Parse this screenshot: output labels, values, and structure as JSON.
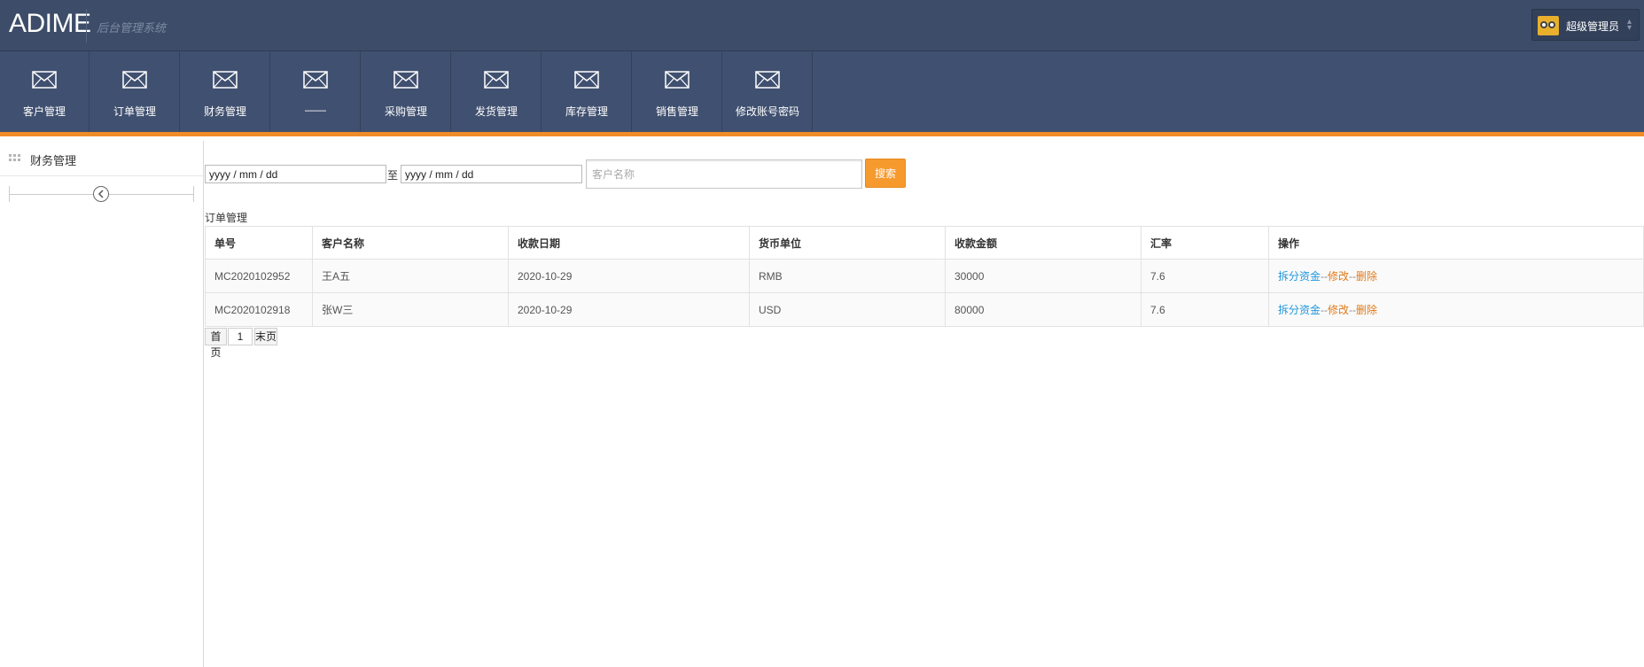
{
  "header": {
    "logo": "ADIME",
    "subtitle": "后台管理系统",
    "user": "超级管理员"
  },
  "nav": {
    "items": [
      {
        "label": "客户管理"
      },
      {
        "label": "订单管理"
      },
      {
        "label": "财务管理"
      },
      {
        "label": "——"
      },
      {
        "label": "采购管理"
      },
      {
        "label": "发货管理"
      },
      {
        "label": "库存管理"
      },
      {
        "label": "销售管理"
      },
      {
        "label": "修改账号密码"
      }
    ],
    "icon": "envelope-icon"
  },
  "sidebar": {
    "title": "财务管理"
  },
  "filter": {
    "date_from": "yyyy / mm / dd",
    "separator": "至",
    "date_to": "yyyy / mm / dd",
    "name_placeholder": "客户名称",
    "search_label": "搜索"
  },
  "section_title": "订单管理",
  "table": {
    "headers": [
      "单号",
      "客户名称",
      "收款日期",
      "货币单位",
      "收款金额",
      "汇率",
      "操作"
    ],
    "rows": [
      {
        "no": "MC2020102952",
        "name": "王A五",
        "date": "2020-10-29",
        "currency": "RMB",
        "amount": "30000",
        "rate": "7.6"
      },
      {
        "no": "MC2020102918",
        "name": "张W三",
        "date": "2020-10-29",
        "currency": "USD",
        "amount": "80000",
        "rate": "7.6"
      }
    ],
    "actions": {
      "split": "拆分资金",
      "sep": "--",
      "edit": "修改",
      "del": "删除"
    }
  },
  "pager": {
    "first": "首页",
    "page": "1",
    "last": "末页"
  },
  "colors": {
    "header_bg": "#3d4c68",
    "nav_bg": "#405070",
    "accent_orange": "#f08c28",
    "search_button": "#f79a2e",
    "link_blue": "#2196dc",
    "link_orange": "#e07a1a"
  }
}
